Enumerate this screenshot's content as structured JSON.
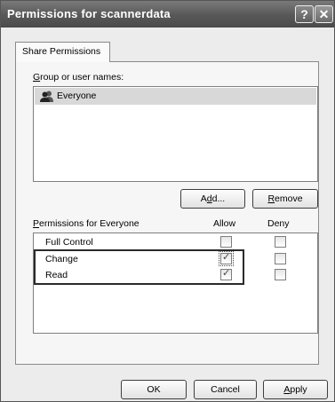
{
  "window": {
    "title": "Permissions for scannerdata",
    "help_label": "?",
    "close_label": "✕"
  },
  "tab": {
    "label": "Share Permissions"
  },
  "group_section": {
    "label_prefix": "",
    "label_access": "G",
    "label_rest": "roup or user names:",
    "items": [
      {
        "name": "Everyone",
        "icon": "users-icon",
        "selected": true
      }
    ]
  },
  "buttons": {
    "add_prefix": "A",
    "add_access": "d",
    "add_rest": "d...",
    "remove_access": "R",
    "remove_rest": "emove",
    "ok": "OK",
    "cancel": "Cancel",
    "apply_access": "A",
    "apply_rest": "pply"
  },
  "permissions": {
    "label_access": "P",
    "label_rest": "ermissions for Everyone",
    "allow_header": "Allow",
    "deny_header": "Deny",
    "rows": [
      {
        "name": "Full Control",
        "allow": false,
        "deny": false
      },
      {
        "name": "Change",
        "allow": true,
        "deny": false
      },
      {
        "name": "Read",
        "allow": true,
        "deny": false
      }
    ]
  }
}
